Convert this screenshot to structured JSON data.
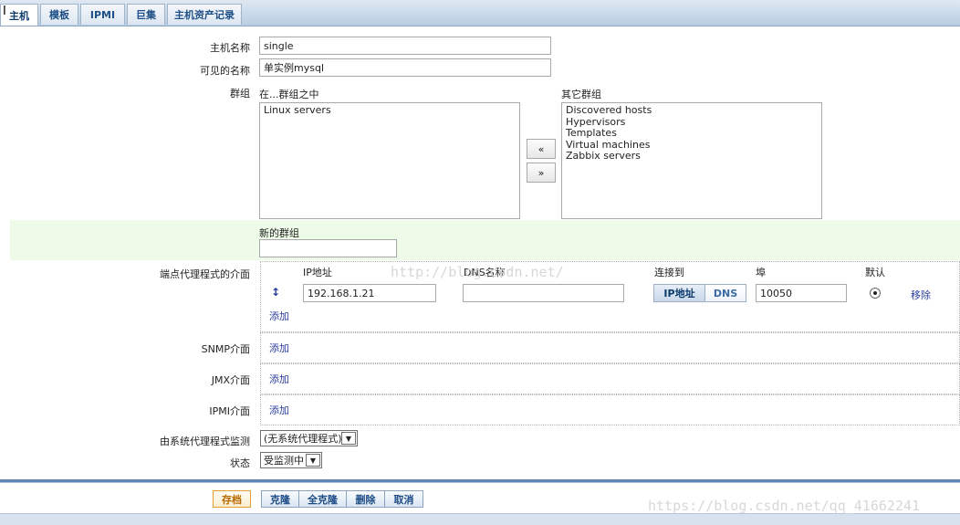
{
  "tabs": [
    {
      "label": "主机",
      "active": true
    },
    {
      "label": "模板",
      "active": false
    },
    {
      "label": "IPMI",
      "active": false
    },
    {
      "label": "巨集",
      "active": false
    },
    {
      "label": "主机资产记录",
      "active": false
    }
  ],
  "form": {
    "hostname_label": "主机名称",
    "hostname_value": "single",
    "visible_name_label": "可见的名称",
    "visible_name_value": "单实例mysql",
    "groups_label": "群组",
    "in_groups_label": "在...群组之中",
    "other_groups_label": "其它群组",
    "in_groups": [
      "Linux servers"
    ],
    "other_groups": [
      "Discovered hosts",
      "Hypervisors",
      "Templates",
      "Virtual machines",
      "Zabbix servers"
    ],
    "move_left": "«",
    "move_right": "»",
    "new_group_label": "新的群组",
    "new_group_value": ""
  },
  "agent_interfaces": {
    "label": "端点代理程式的介面",
    "col_ip": "IP地址",
    "col_dns": "DNS名称",
    "col_connect": "连接到",
    "col_port": "埠",
    "col_default": "默认",
    "ip_value": "192.168.1.21",
    "dns_value": "",
    "connect_ip": "IP地址",
    "connect_dns": "DNS",
    "port_value": "10050",
    "remove": "移除",
    "add": "添加",
    "default_selected": true
  },
  "snmp": {
    "label": "SNMP介面",
    "add": "添加"
  },
  "jmx": {
    "label": "JMX介面",
    "add": "添加"
  },
  "ipmi": {
    "label": "IPMI介面",
    "add": "添加"
  },
  "proxy": {
    "label": "由系统代理程式监测",
    "value": "(无系统代理程式)"
  },
  "status": {
    "label": "状态",
    "value": "受监测中"
  },
  "footer": {
    "save": "存档",
    "clone": "克隆",
    "full_clone": "全克隆",
    "delete": "删除",
    "cancel": "取消"
  },
  "watermarks": {
    "mid": "http://blog.csdn.net/",
    "bottom": "https://blog.csdn.net/qq_41662241"
  }
}
